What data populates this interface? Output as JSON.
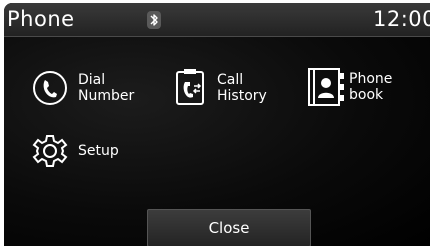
{
  "header": {
    "title": "Phone",
    "time": "12:00",
    "bluetooth_icon": "bluetooth-icon"
  },
  "menu": {
    "dial_number": {
      "label": "Dial\nNumber",
      "icon": "handset-icon"
    },
    "call_history": {
      "label": "Call\nHistory",
      "icon": "call-history-icon"
    },
    "phone_book": {
      "label": "Phone\nbook",
      "icon": "phonebook-icon"
    },
    "setup": {
      "label": "Setup",
      "icon": "gear-icon"
    }
  },
  "footer": {
    "close_label": "Close"
  },
  "colors": {
    "background": "#000000",
    "header": "#2e2e2e",
    "text": "#ffffff"
  }
}
